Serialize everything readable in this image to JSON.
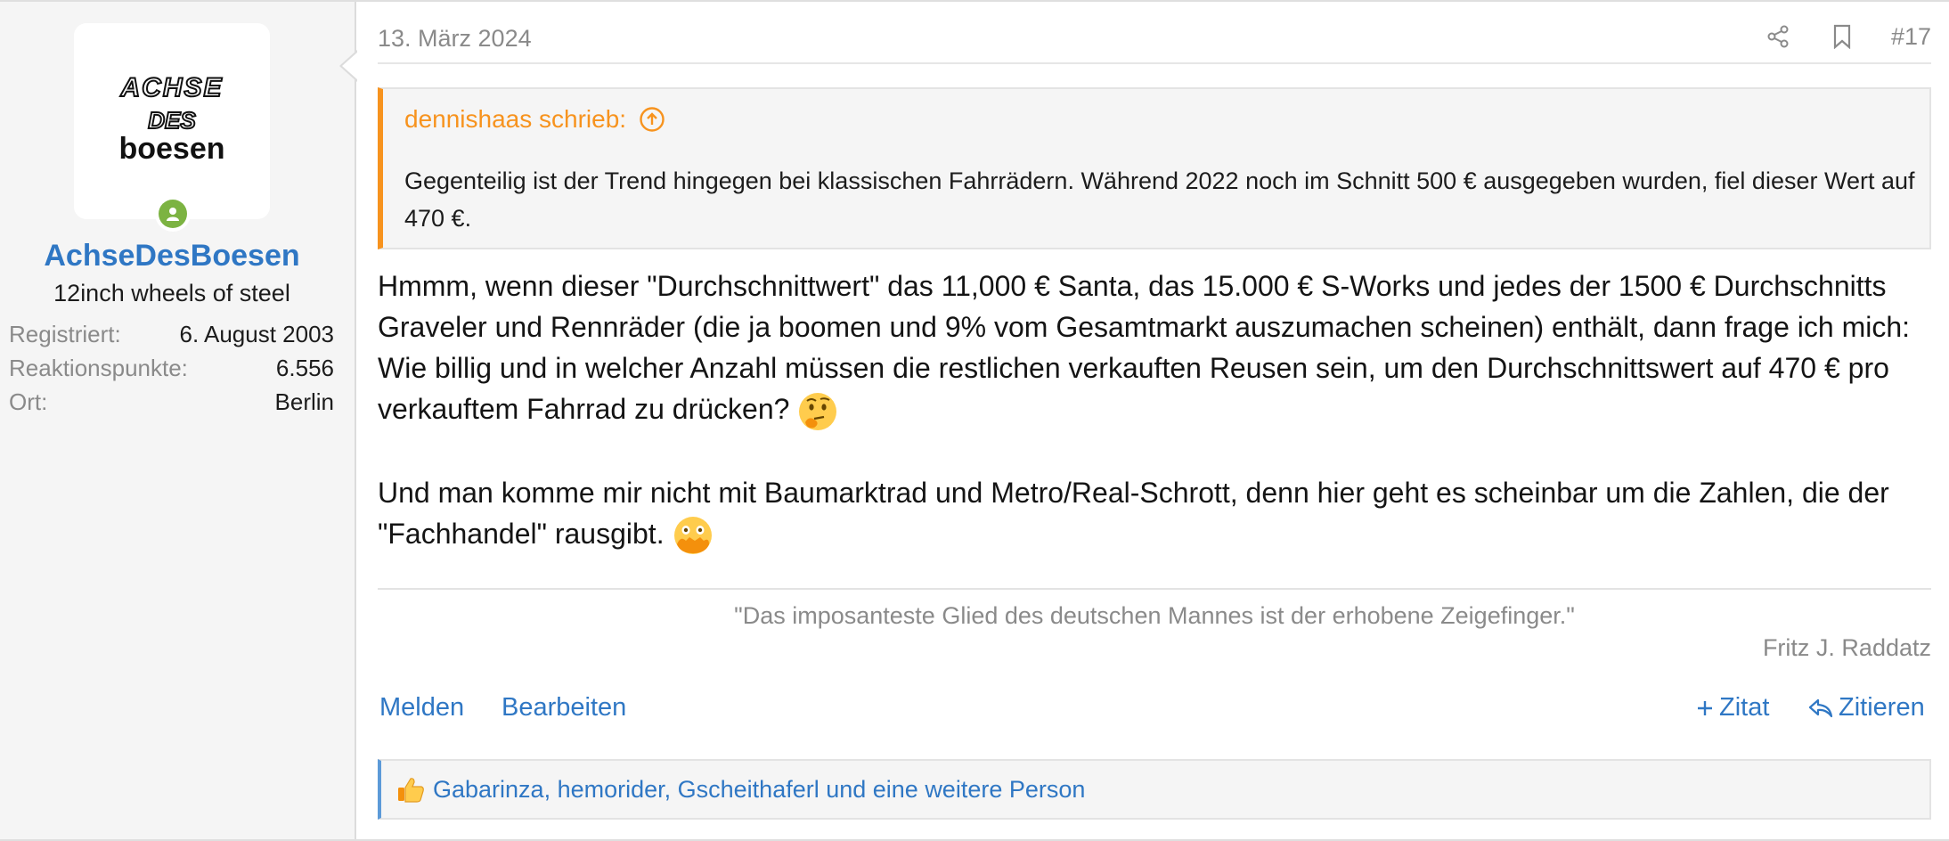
{
  "user": {
    "name": "AchseDesBoesen",
    "title": "12inch wheels of steel",
    "logo_text": [
      "ACHSE",
      "DES",
      "boesen"
    ],
    "stats": [
      {
        "label": "Registriert:",
        "value": "6. August 2003"
      },
      {
        "label": "Reaktionspunkte:",
        "value": "6.556"
      },
      {
        "label": "Ort:",
        "value": "Berlin"
      }
    ]
  },
  "post": {
    "date": "13. März 2024",
    "number": "#17",
    "icons": [
      "share-icon",
      "bookmark-icon"
    ]
  },
  "quote": {
    "author": "dennishaas schrieb:",
    "text": "Gegenteilig ist der Trend hingegen bei klassischen Fahrrädern. Während 2022 noch im Schnitt 500 € ausgegeben wurden, fiel dieser Wert auf 470 €."
  },
  "message": {
    "paragraph1": "Hmmm, wenn dieser \"Durchschnittwert\" das 11,000 € Santa, das 15.000 € S-Works und jedes der 1500 € Durchschnitts Graveler und Rennräder (die ja boomen und 9% vom Gesamtmarkt auszumachen scheinen) enthält, dann frage ich mich: Wie billig und in welcher Anzahl müssen die restlichen verkauften Reusen sein, um den Durchschnittswert auf 470 € pro verkauftem Fahrrad zu drücken?",
    "paragraph2": "Und man komme mir nicht mit Baumarktrad und Metro/Real-Schrott, denn hier geht es scheinbar um die Zahlen, die der \"Fachhandel\" rausgibt.",
    "emoji1": "thinking-face",
    "emoji2": "face-with-hand-over-mouth"
  },
  "signature": {
    "quote": "\"Das imposanteste Glied des deutschen Mannes ist der erhobene Zeigefinger.\"",
    "author": "Fritz J. Raddatz"
  },
  "actions": {
    "report": "Melden",
    "edit": "Bearbeiten",
    "multiquote": "Zitat",
    "reply": "Zitieren"
  },
  "reactions": {
    "text": "Gabarinza, hemorider, Gscheithaferl und eine weitere Person"
  },
  "colors": {
    "link": "#2f77c4",
    "quote_accent": "#f7931e",
    "online": "#7cb342"
  }
}
